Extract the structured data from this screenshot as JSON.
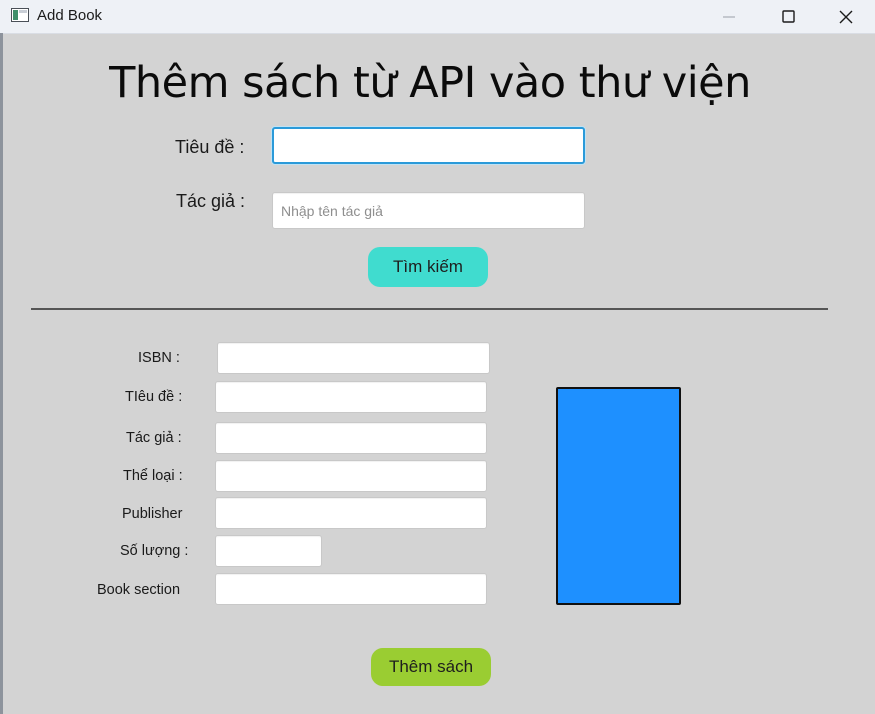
{
  "window": {
    "title": "Add Book",
    "controls": [
      "minimize-icon",
      "maximize-icon",
      "close-icon"
    ]
  },
  "heading": "Thêm sách từ API vào thư viện",
  "search": {
    "title_label": "Tiêu đề :",
    "title_value": "",
    "author_label": "Tác giả :",
    "author_placeholder": "Nhập tên tác giả",
    "button_label": "Tìm kiếm"
  },
  "details": {
    "isbn_label": "ISBN :",
    "title_label": "TIêu đề :",
    "author_label": "Tác giả :",
    "genre_label": "Thể loại :",
    "publisher_label": "Publisher",
    "quantity_label": "Số lượng :",
    "section_label": "Book section"
  },
  "add_button_label": "Thêm sách",
  "colors": {
    "search_button": "#40dccf",
    "add_button": "#9acd32",
    "cover": "#1e90ff",
    "background": "#d3d3d3"
  }
}
